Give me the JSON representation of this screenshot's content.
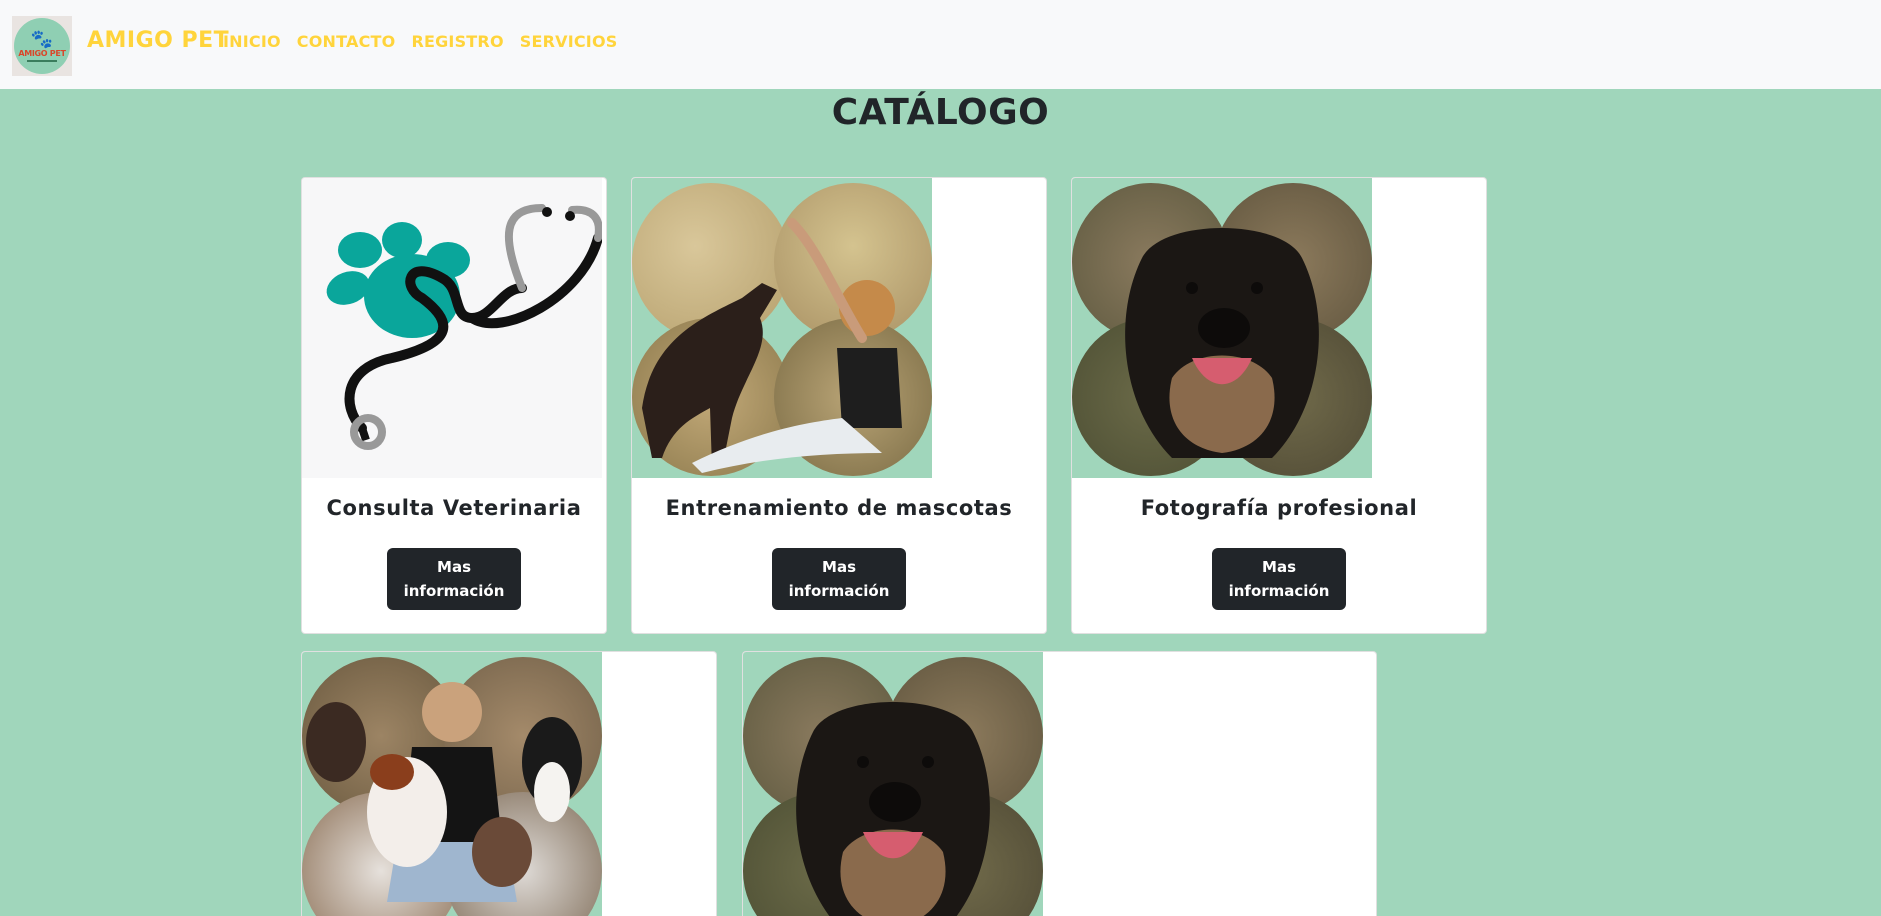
{
  "navbar": {
    "brand": "AMIGO PET",
    "logo_text": "AMIGO PET",
    "links": [
      "INICIO",
      "CONTACTO",
      "REGISTRO",
      "SERVICIOS"
    ]
  },
  "page": {
    "title": "CATÁLOGO"
  },
  "cards": [
    {
      "title": "Consulta Veterinaria",
      "button": "Mas información",
      "image": "paw-stethoscope-icon"
    },
    {
      "title": "Entrenamiento de mascotas",
      "button": "Mas información",
      "image": "woman-training-dog-photo"
    },
    {
      "title": "Fotografía profesional",
      "button": "Mas información",
      "image": "dog-portrait-photo"
    },
    {
      "title": "",
      "button": "",
      "image": "woman-with-dogs-photo"
    },
    {
      "title": "",
      "button": "",
      "image": "dog-portrait-photo"
    }
  ],
  "colors": {
    "background": "#a0d6bb",
    "navbar": "#f8f9fa",
    "brand": "#ffd43b",
    "button": "#212529"
  }
}
